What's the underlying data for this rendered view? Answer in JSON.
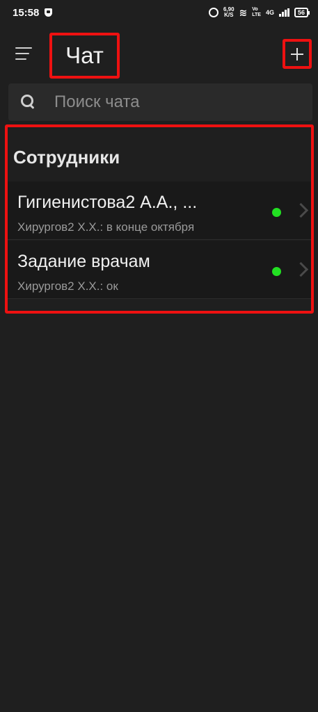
{
  "status_bar": {
    "time": "15:58",
    "speed_value": "6,90",
    "speed_unit": "K/S",
    "net_top": "Vo",
    "net_bottom": "LTE",
    "signal_label": "4G",
    "battery": "56"
  },
  "header": {
    "title": "Чат"
  },
  "search": {
    "placeholder": "Поиск чата"
  },
  "section": {
    "title": "Сотрудники"
  },
  "chats": [
    {
      "name": "Гигиенистова2 А.А., ...",
      "preview": "Хирургов2 Х.Х.: в конце октября",
      "online": true
    },
    {
      "name": "Задание врачам",
      "preview": "Хирургов2 Х.Х.: ок",
      "online": true
    }
  ],
  "colors": {
    "background": "#1f1f1f",
    "highlight": "#ee1111",
    "online": "#22e022"
  },
  "icons": [
    "shield-icon",
    "alarm-icon",
    "wifi-icon",
    "signal-icon",
    "battery-icon",
    "menu-icon",
    "plus-icon",
    "search-icon",
    "chevron-right-icon"
  ]
}
